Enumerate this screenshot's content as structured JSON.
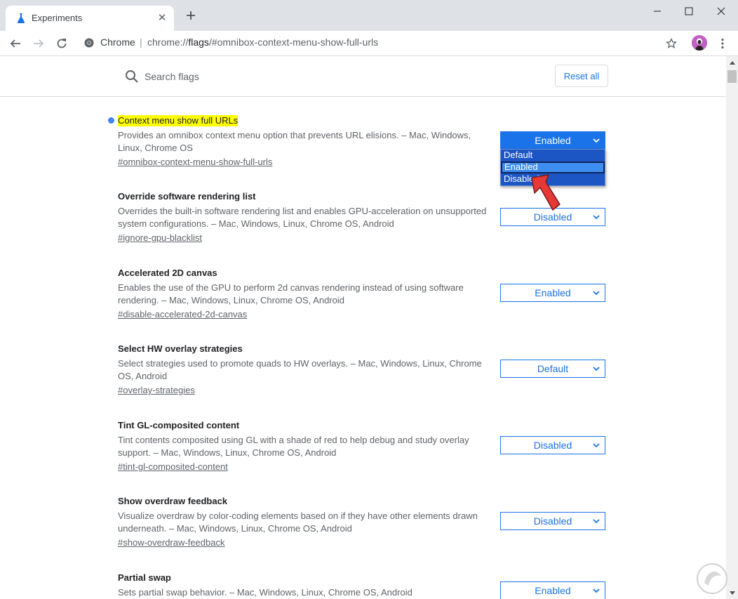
{
  "window": {
    "tab_title": "Experiments",
    "new_tab_icon": "plus-icon",
    "controls": [
      "minimize-icon",
      "maximize-icon",
      "close-icon"
    ]
  },
  "toolbar": {
    "site_label": "Chrome",
    "url_scheme": "chrome://",
    "url_host": "flags",
    "url_path": "/#omnibox-context-menu-show-full-urls"
  },
  "header": {
    "search_placeholder": "Search flags",
    "reset_label": "Reset all"
  },
  "experiments": [
    {
      "name": "Context menu show full URLs",
      "description": "Provides an omnibox context menu option that prevents URL elisions. – Mac, Windows, Linux, Chrome OS",
      "link": "#omnibox-context-menu-show-full-urls",
      "value": "Enabled",
      "highlighted": true,
      "modified": true
    },
    {
      "name": "Override software rendering list",
      "description": "Overrides the built-in software rendering list and enables GPU-acceleration on unsupported system configurations. – Mac, Windows, Linux, Chrome OS, Android",
      "link": "#ignore-gpu-blacklist",
      "value": "Disabled"
    },
    {
      "name": "Accelerated 2D canvas",
      "description": "Enables the use of the GPU to perform 2d canvas rendering instead of using software rendering. – Mac, Windows, Linux, Chrome OS, Android",
      "link": "#disable-accelerated-2d-canvas",
      "value": "Enabled"
    },
    {
      "name": "Select HW overlay strategies",
      "description": "Select strategies used to promote quads to HW overlays. – Mac, Windows, Linux, Chrome OS, Android",
      "link": "#overlay-strategies",
      "value": "Default"
    },
    {
      "name": "Tint GL-composited content",
      "description": "Tint contents composited using GL with a shade of red to help debug and study overlay support. – Mac, Windows, Linux, Chrome OS, Android",
      "link": "#tint-gl-composited-content",
      "value": "Disabled"
    },
    {
      "name": "Show overdraw feedback",
      "description": "Visualize overdraw by color-coding elements based on if they have other elements drawn underneath. – Mac, Windows, Linux, Chrome OS, Android",
      "link": "#show-overdraw-feedback",
      "value": "Disabled"
    },
    {
      "name": "Partial swap",
      "description": "Sets partial swap behavior. – Mac, Windows, Linux, Chrome OS, Android",
      "link": "",
      "value": "Enabled"
    }
  ],
  "dropdown": {
    "options": [
      "Default",
      "Enabled",
      "Disabled"
    ],
    "selected": "Enabled"
  },
  "colors": {
    "accent": "#1a73e8",
    "highlight": "#ffff00",
    "dropdown_bg": "#1b56c4",
    "annotation_arrow": "#e53935"
  }
}
